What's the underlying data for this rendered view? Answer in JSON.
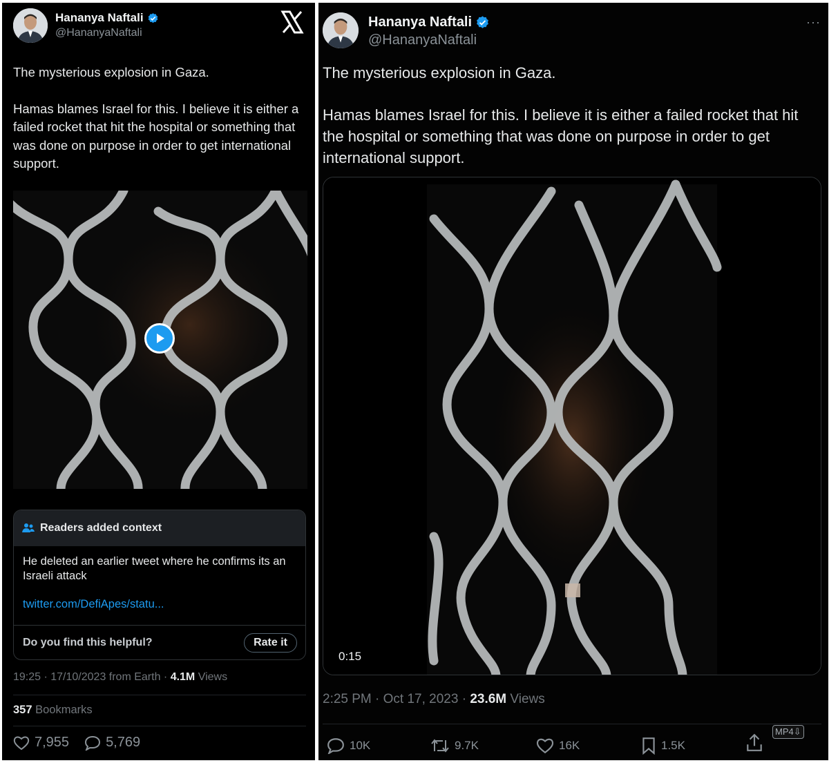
{
  "colors": {
    "accent": "#1d9bf0",
    "background": "#000000",
    "text": "#e7e9ea",
    "muted": "#71767b"
  },
  "left": {
    "author": {
      "name": "Hananya Naftali",
      "handle": "@HananyaNaftali",
      "verified": true
    },
    "brand_icon": "x-logo-icon",
    "tweet": {
      "line1": "The mysterious explosion in Gaza.",
      "line2": "Hamas blames Israel for this. I believe it is either a failed rocket that hit the hospital or something that was done on purpose in order to get international support."
    },
    "context": {
      "title": "Readers added context",
      "body": "He deleted an earlier tweet where he confirms its an Israeli attack",
      "link": "twitter.com/DefiApes/statu...",
      "helpful_question": "Do you find this helpful?",
      "rate_label": "Rate it"
    },
    "meta": {
      "time": "19:25 · 17/10/2023 from Earth · ",
      "views_count": "4.1M",
      "views_label": " Views"
    },
    "bookmarks": {
      "count": "357",
      "label": " Bookmarks"
    },
    "stats": {
      "likes": "7,955",
      "replies": "5,769"
    }
  },
  "right": {
    "author": {
      "name": "Hananya Naftali",
      "handle": "@HananyaNaftali",
      "verified": true
    },
    "more_label": "···",
    "tweet": {
      "line1": "The mysterious explosion in Gaza.",
      "line2": "Hamas blames Israel for this. I believe it is either a failed rocket that hit the hospital or something that was done on purpose in order to get international support."
    },
    "video": {
      "duration": "0:15"
    },
    "meta": {
      "time": "2:25 PM · Oct 17, 2023 · ",
      "views_count": "23.6M",
      "views_label": " Views"
    },
    "stats": {
      "replies": "10K",
      "reposts": "9.7K",
      "likes": "16K",
      "bookmarks": "1.5K"
    },
    "badge": "MP4⇩"
  }
}
